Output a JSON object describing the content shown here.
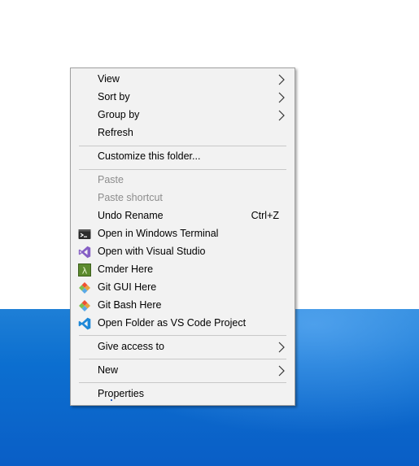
{
  "menu": {
    "items": [
      {
        "label": "View",
        "submenu": true
      },
      {
        "label": "Sort by",
        "submenu": true
      },
      {
        "label": "Group by",
        "submenu": true
      },
      {
        "label": "Refresh"
      },
      {
        "label": "Customize this folder..."
      },
      {
        "label": "Paste",
        "disabled": true
      },
      {
        "label": "Paste shortcut",
        "disabled": true
      },
      {
        "label": "Undo Rename",
        "shortcut": "Ctrl+Z"
      },
      {
        "label": "Open in Windows Terminal",
        "icon": "windows-terminal-icon"
      },
      {
        "label": "Open with Visual Studio",
        "icon": "visual-studio-icon"
      },
      {
        "label": "Cmder Here",
        "icon": "cmder-lambda-icon"
      },
      {
        "label": "Git GUI Here",
        "icon": "git-gui-icon"
      },
      {
        "label": "Git Bash Here",
        "icon": "git-bash-icon"
      },
      {
        "label": "Open Folder as VS Code Project",
        "icon": "vscode-icon"
      },
      {
        "label": "Give access to",
        "submenu": true
      },
      {
        "label": "New",
        "submenu": true
      },
      {
        "label": "Properties"
      }
    ]
  },
  "colors": {
    "menu_bg": "#f2f2f2",
    "disabled_text": "#8d8d8d",
    "desktop_blue": "#0c6fd0",
    "vs_purple": "#865fc5",
    "cmder_green": "#5c8a2e",
    "vscode_blue": "#1e88d8"
  }
}
